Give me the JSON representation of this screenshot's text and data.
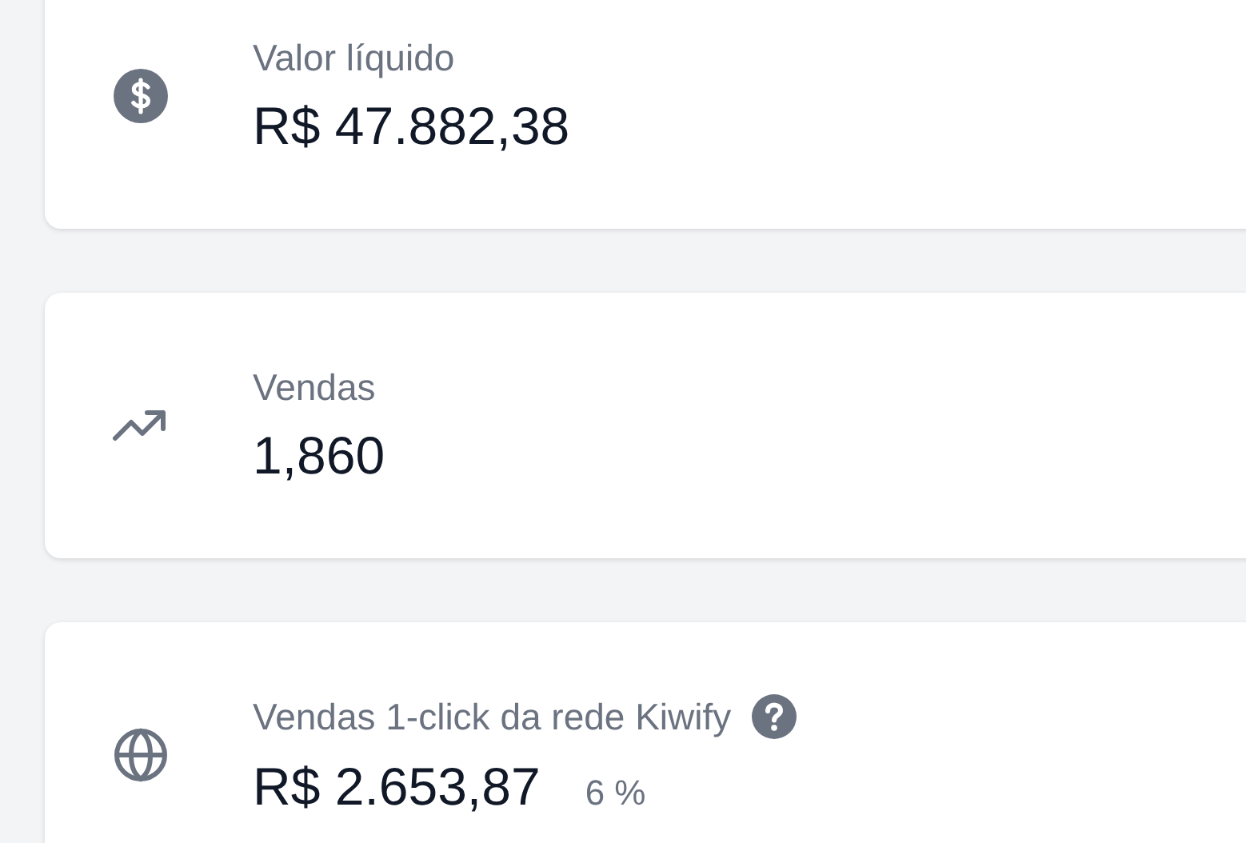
{
  "cards": [
    {
      "label": "Valor líquido",
      "value": "R$ 47.882,38",
      "help": false
    },
    {
      "label": "Vendas",
      "value": "1,860",
      "help": false
    },
    {
      "label": "Vendas 1-click da rede Kiwify",
      "value": "R$ 2.653,87",
      "percent": "6 %",
      "help": true
    }
  ]
}
